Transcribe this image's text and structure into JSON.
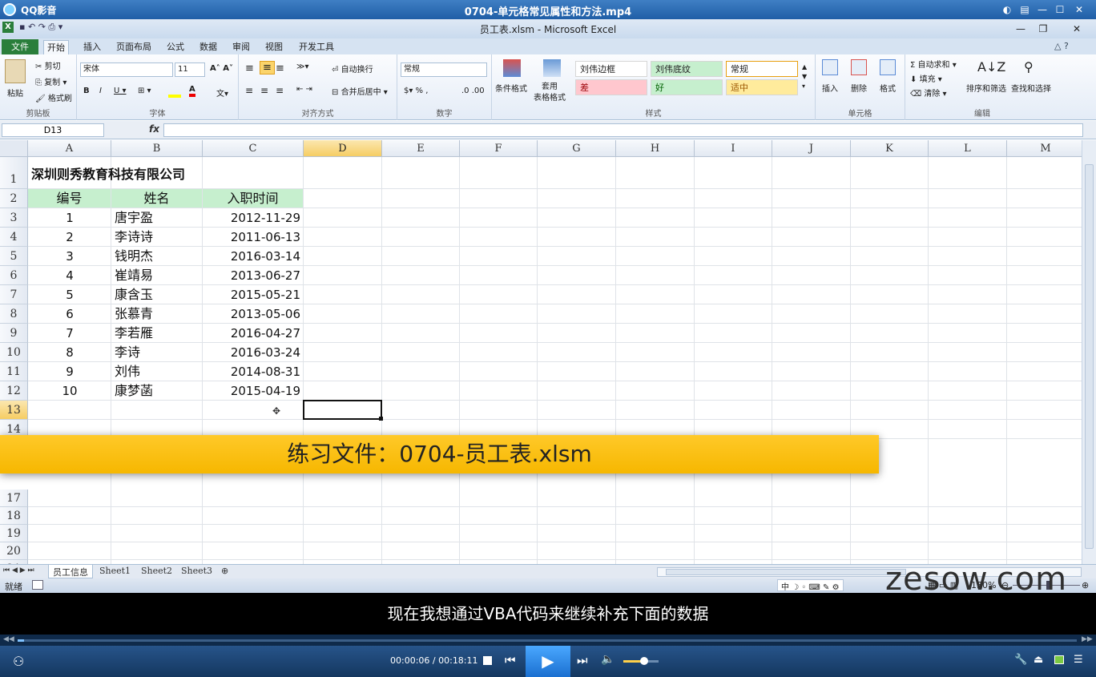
{
  "player": {
    "app_name": "QQ影音",
    "video_title": "0704-单元格常见属性和方法.mp4",
    "time_current": "00:00:06",
    "time_total": "00:18:11",
    "subtitle": "现在我想通过VBA代码来继续补充下面的数据",
    "progress_fraction": 0.006,
    "volume_fraction": 0.6
  },
  "excel": {
    "window_title": "员工表.xlsm - Microsoft Excel",
    "tabs": [
      "文件",
      "开始",
      "插入",
      "页面布局",
      "公式",
      "数据",
      "审阅",
      "视图",
      "开发工具"
    ],
    "clipboard": {
      "paste": "粘贴",
      "cut": "剪切",
      "copy": "复制",
      "format_painter": "格式刷",
      "label": "剪贴板"
    },
    "font": {
      "name": "宋体",
      "size": "11",
      "label": "字体"
    },
    "alignment": {
      "wrap": "自动换行",
      "merge": "合并后居中",
      "label": "对齐方式"
    },
    "number": {
      "format": "常规",
      "label": "数字"
    },
    "styles": {
      "cond_format": "条件格式",
      "table_format": "套用\n表格格式",
      "items": [
        "刘伟边框",
        "刘伟底纹",
        "常规",
        "差",
        "好",
        "适中"
      ],
      "label": "样式"
    },
    "cells_group": {
      "insert": "插入",
      "delete": "删除",
      "format": "格式",
      "label": "单元格"
    },
    "editing": {
      "autosum": "自动求和",
      "fill": "填充",
      "clear": "清除",
      "sort": "排序和筛选",
      "find": "查找和选择",
      "label": "编辑"
    },
    "name_box": "D13",
    "fx": "fx",
    "columns": [
      "A",
      "B",
      "C",
      "D",
      "E",
      "F",
      "G",
      "H",
      "I",
      "J",
      "K",
      "L",
      "M"
    ],
    "rows_visible": [
      "1",
      "2",
      "3",
      "4",
      "5",
      "6",
      "7",
      "8",
      "9",
      "10",
      "11",
      "12",
      "13",
      "14",
      "17",
      "18",
      "19",
      "20",
      "21"
    ],
    "sheet": {
      "title": "深圳则秀教育科技有限公司",
      "headers": [
        "编号",
        "姓名",
        "入职时间"
      ],
      "data": [
        [
          "1",
          "唐宇盈",
          "2012-11-29"
        ],
        [
          "2",
          "李诗诗",
          "2011-06-13"
        ],
        [
          "3",
          "钱明杰",
          "2016-03-14"
        ],
        [
          "4",
          "崔靖易",
          "2013-06-27"
        ],
        [
          "5",
          "康含玉",
          "2015-05-21"
        ],
        [
          "6",
          "张慕青",
          "2013-05-06"
        ],
        [
          "7",
          "李若雁",
          "2016-04-27"
        ],
        [
          "8",
          "李诗",
          "2016-03-24"
        ],
        [
          "9",
          "刘伟",
          "2014-08-31"
        ],
        [
          "10",
          "康梦菡",
          "2015-04-19"
        ]
      ]
    },
    "sheet_tabs": [
      "员工信息",
      "Sheet1",
      "Sheet2",
      "Sheet3"
    ],
    "status_ready": "就绪",
    "zoom": "130%",
    "ime_indicator": "中"
  },
  "overlay": {
    "banner": "练习文件：0704-员工表.xlsm",
    "watermark": "zesow.com"
  },
  "colors": {
    "header_fill": "#c6efce",
    "banner": "#f8bd00",
    "file_tab": "#2a7e3b"
  }
}
